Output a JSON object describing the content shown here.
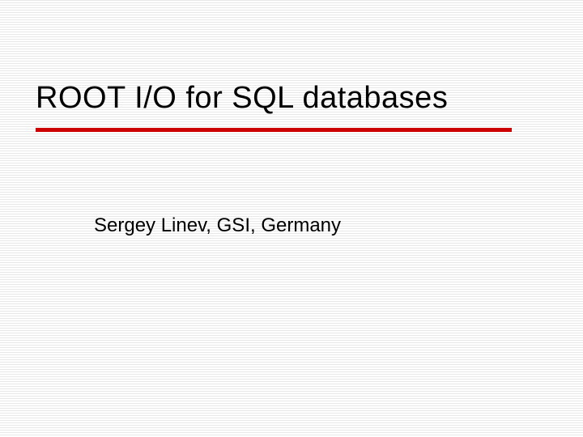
{
  "slide": {
    "title": "ROOT I/O for SQL databases",
    "subtitle": "Sergey Linev, GSI, Germany"
  }
}
